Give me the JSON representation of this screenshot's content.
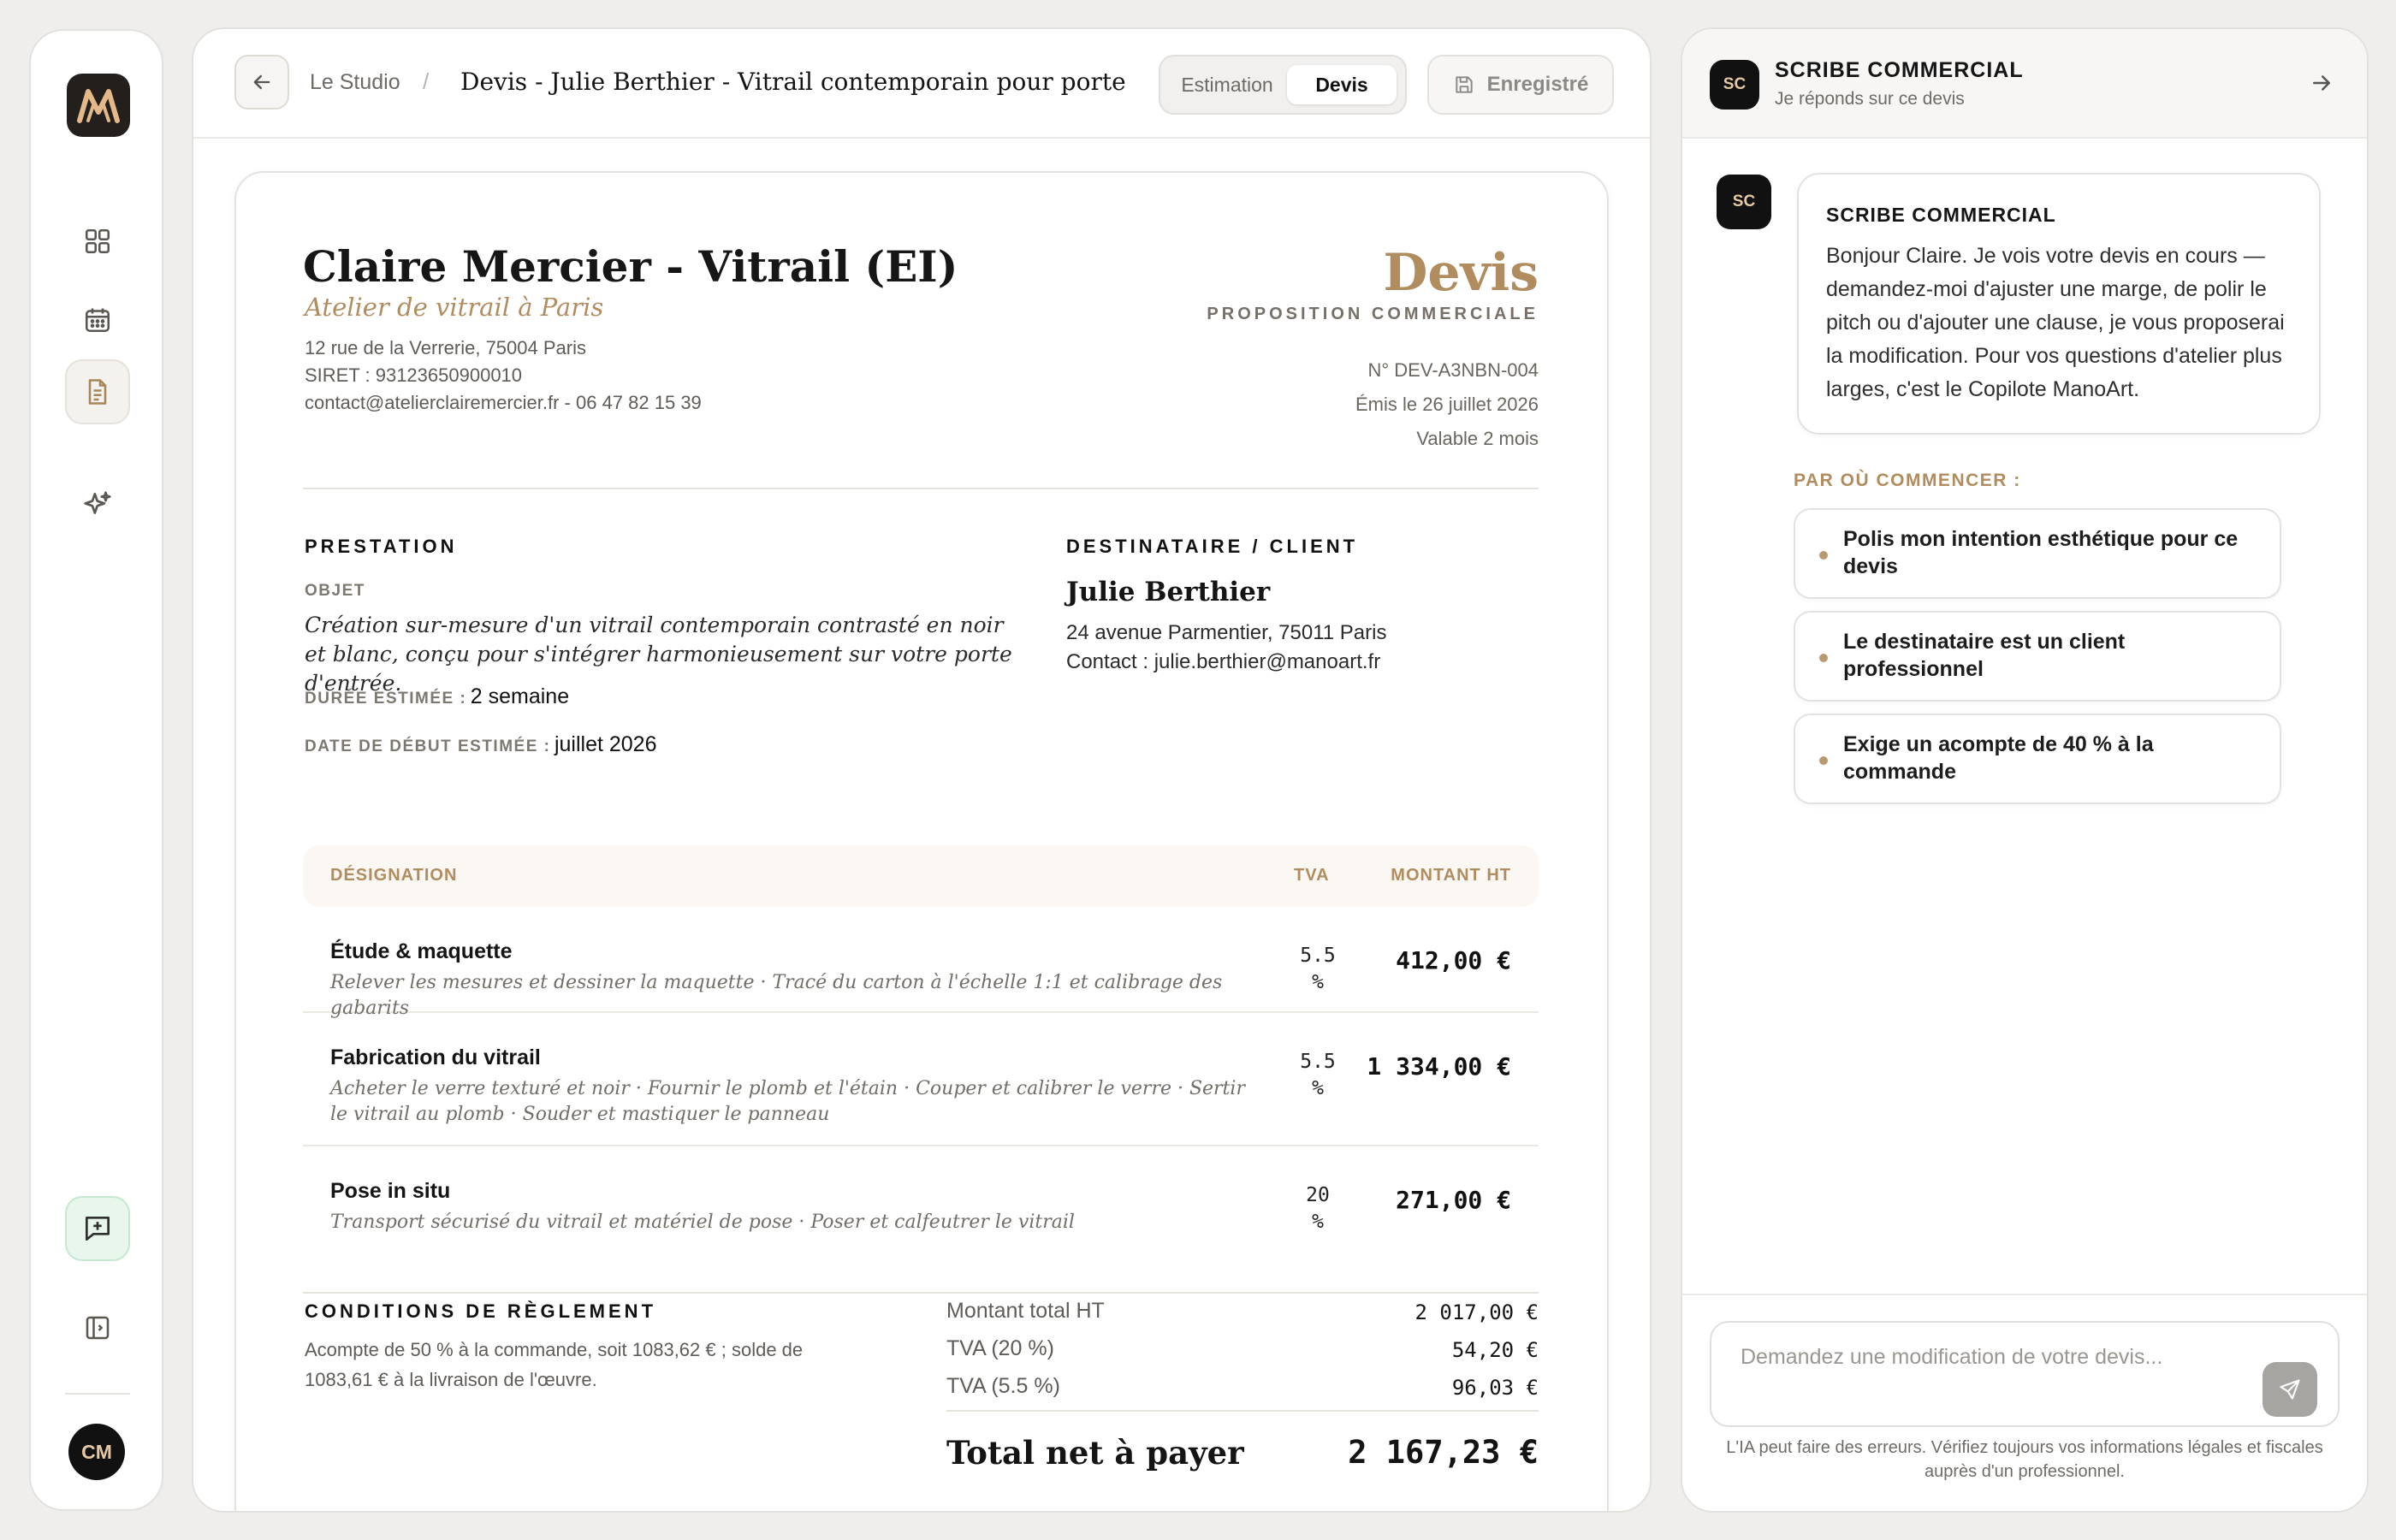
{
  "sidebar": {
    "avatar_initials": "CM",
    "icons": [
      "grid-icon",
      "calendar-icon",
      "document-icon",
      "sparkle-icon",
      "new-chat-icon",
      "sidebar-toggle-icon"
    ]
  },
  "header": {
    "breadcrumb_parent": "Le Studio",
    "breadcrumb_separator": "/",
    "breadcrumb_current": "Devis - Julie Berthier - Vitrail contemporain pour porte",
    "tabs": [
      "Estimation",
      "Devis"
    ],
    "active_tab": "Devis",
    "save_label": "Enregistré"
  },
  "document": {
    "company_name": "Claire Mercier - Vitrail (EI)",
    "tagline": "Atelier de vitrail à Paris",
    "address": "12 rue de la Verrerie, 75004 Paris",
    "siret": "SIRET : 93123650900010",
    "contact": "contact@atelierclairemercier.fr - 06 47 82 15 39",
    "doc_title": "Devis",
    "doc_subtitle": "PROPOSITION COMMERCIALE",
    "number": "N° DEV-A3NBN-004",
    "issued": "Émis le 26 juillet 2026",
    "validity": "Valable 2 mois",
    "prestation_heading": "PRESTATION",
    "objet_label": "OBJET",
    "objet_text": "Création sur-mesure d'un vitrail contemporain contrasté en noir et blanc, conçu pour s'intégrer harmonieusement sur votre porte d'entrée.",
    "duree_label": "DURÉE ESTIMÉE :",
    "duree_value": "2 semaine",
    "debut_label": "DATE DE DÉBUT ESTIMÉE :",
    "debut_value": "juillet 2026",
    "client_heading": "DESTINATAIRE / CLIENT",
    "client_name": "Julie Berthier",
    "client_address": "24 avenue Parmentier, 75011 Paris",
    "client_contact": "Contact : julie.berthier@manoart.fr",
    "table": {
      "headers": [
        "DÉSIGNATION",
        "TVA",
        "MONTANT HT"
      ],
      "rows": [
        {
          "title": "Étude & maquette",
          "desc": "Relever les mesures et dessiner la maquette · Tracé du carton à l'échelle 1:1 et calibrage des gabarits",
          "tva": "5.5",
          "tva_unit": "%",
          "amount": "412,00 €"
        },
        {
          "title": "Fabrication du vitrail",
          "desc": "Acheter le verre texturé et noir · Fournir le plomb et l'étain · Couper et calibrer le verre · Sertir le vitrail au plomb · Souder et mastiquer le panneau",
          "tva": "5.5",
          "tva_unit": "%",
          "amount": "1 334,00 €"
        },
        {
          "title": "Pose in situ",
          "desc": "Transport sécurisé du vitrail et matériel de pose · Poser et calfeutrer le vitrail",
          "tva": "20",
          "tva_unit": "%",
          "amount": "271,00 €"
        }
      ]
    },
    "conditions_heading": "CONDITIONS DE RÈGLEMENT",
    "conditions_text": "Acompte de 50 % à la commande, soit 1083,62 € ; solde de 1083,61 € à la livraison de l'œuvre.",
    "totals": [
      {
        "label": "Montant total HT",
        "value": "2 017,00 €"
      },
      {
        "label": "TVA (20 %)",
        "value": "54,20 €"
      },
      {
        "label": "TVA (5.5 %)",
        "value": "96,03 €"
      }
    ],
    "grand_total_label": "Total net à payer",
    "grand_total_value": "2 167,23 €"
  },
  "assistant": {
    "badge": "SC",
    "title": "SCRIBE COMMERCIAL",
    "subtitle": "Je réponds sur ce devis",
    "message_author": "SCRIBE COMMERCIAL",
    "message_text": "Bonjour Claire. Je vois votre devis en cours — demandez-moi d'ajuster une marge, de polir le pitch ou d'ajouter une clause, je vous proposerai la modification. Pour vos questions d'atelier plus larges, c'est le Copilote ManoArt.",
    "starters_label": "PAR OÙ COMMENCER :",
    "starters": [
      "Polis mon intention esthétique pour ce devis",
      "Le destinataire est un client professionnel",
      "Exige un acompte de 40 % à la commande"
    ],
    "input_placeholder": "Demandez une modification de votre devis...",
    "disclaimer": "L'IA peut faire des erreurs. Vérifiez toujours vos informations légales et fiscales auprès d'un professionnel."
  },
  "colors": {
    "accent": "#b08c5e",
    "dark": "#111111",
    "background": "#efeeec",
    "success_bg": "#e8f6ec"
  }
}
